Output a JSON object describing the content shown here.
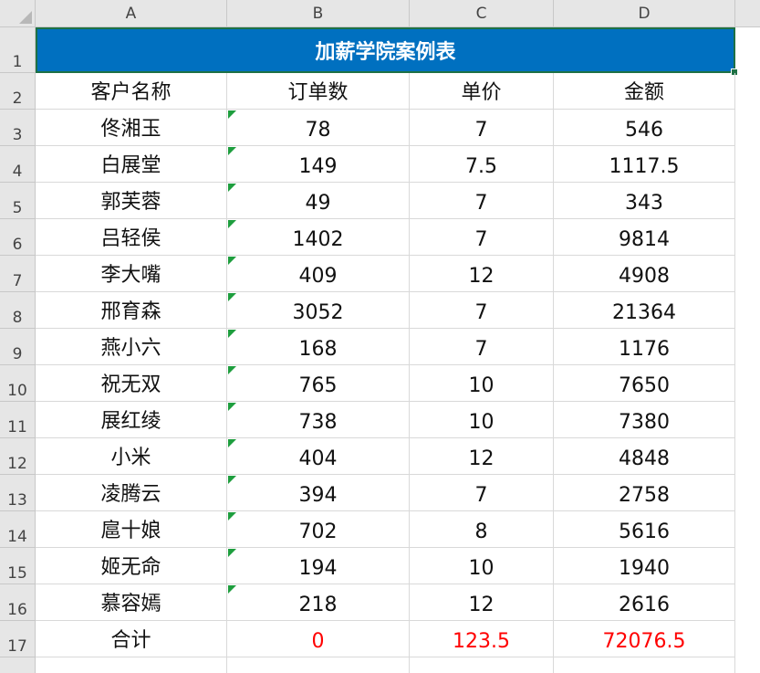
{
  "columns": [
    "A",
    "B",
    "C",
    "D"
  ],
  "rows": [
    "1",
    "2",
    "3",
    "4",
    "5",
    "6",
    "7",
    "8",
    "9",
    "10",
    "11",
    "12",
    "13",
    "14",
    "15",
    "16",
    "17"
  ],
  "title": "加薪学院案例表",
  "headers": [
    "客户名称",
    "订单数",
    "单价",
    "金额"
  ],
  "records": [
    {
      "name": "佟湘玉",
      "orders": "78",
      "price": "7",
      "amount": "546"
    },
    {
      "name": "白展堂",
      "orders": "149",
      "price": "7.5",
      "amount": "1117.5"
    },
    {
      "name": "郭芙蓉",
      "orders": "49",
      "price": "7",
      "amount": "343"
    },
    {
      "name": "吕轻侯",
      "orders": "1402",
      "price": "7",
      "amount": "9814"
    },
    {
      "name": "李大嘴",
      "orders": "409",
      "price": "12",
      "amount": "4908"
    },
    {
      "name": "邢育森",
      "orders": "3052",
      "price": "7",
      "amount": "21364"
    },
    {
      "name": "燕小六",
      "orders": "168",
      "price": "7",
      "amount": "1176"
    },
    {
      "name": "祝无双",
      "orders": "765",
      "price": "10",
      "amount": "7650"
    },
    {
      "name": "展红绫",
      "orders": "738",
      "price": "10",
      "amount": "7380"
    },
    {
      "name": "小米",
      "orders": "404",
      "price": "12",
      "amount": "4848"
    },
    {
      "name": "凌腾云",
      "orders": "394",
      "price": "7",
      "amount": "2758"
    },
    {
      "name": "扈十娘",
      "orders": "702",
      "price": "8",
      "amount": "5616"
    },
    {
      "name": "姬无命",
      "orders": "194",
      "price": "10",
      "amount": "1940"
    },
    {
      "name": "慕容嫣",
      "orders": "218",
      "price": "12",
      "amount": "2616"
    }
  ],
  "total": {
    "label": "合计",
    "orders": "0",
    "price": "123.5",
    "amount": "72076.5"
  },
  "colors": {
    "title_fill": "#0070c0",
    "title_text": "#ffffff",
    "total_text": "#ff0000",
    "number_flag": "#1e9e3e",
    "selection_border": "#1e7145"
  }
}
